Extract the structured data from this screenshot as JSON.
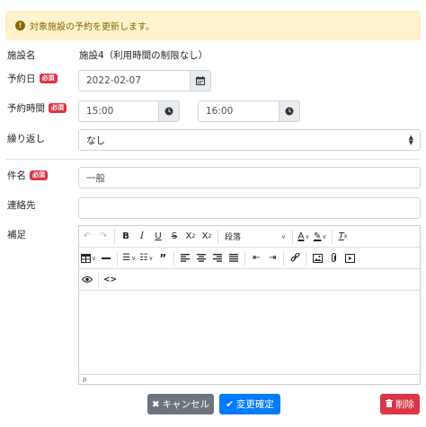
{
  "alert": {
    "icon": "exclamation-circle-icon",
    "text": "対象施設の予約を更新します。"
  },
  "required_badge": "必須",
  "facility": {
    "label": "施設名",
    "value": "施設4（利用時間の制限なし）"
  },
  "date": {
    "label": "予約日",
    "value": "2022-02-07",
    "icon": "calendar-icon"
  },
  "time": {
    "label": "予約時間",
    "start": "15:00",
    "end": "16:00",
    "icon": "clock-icon"
  },
  "repeat": {
    "label": "繰り返し",
    "value": "なし"
  },
  "subject": {
    "label": "件名",
    "value": "一般"
  },
  "contact": {
    "label": "連絡先",
    "value": ""
  },
  "notes": {
    "label": "補足",
    "block_format": "段落",
    "status_path": "p"
  },
  "buttons": {
    "cancel": "キャンセル",
    "confirm": "変更確定",
    "delete": "削除"
  },
  "colors": {
    "alert_bg": "#fff3cd",
    "required": "#dc3545",
    "cancel": "#6c757d",
    "confirm": "#007bff",
    "delete": "#dc3545"
  }
}
